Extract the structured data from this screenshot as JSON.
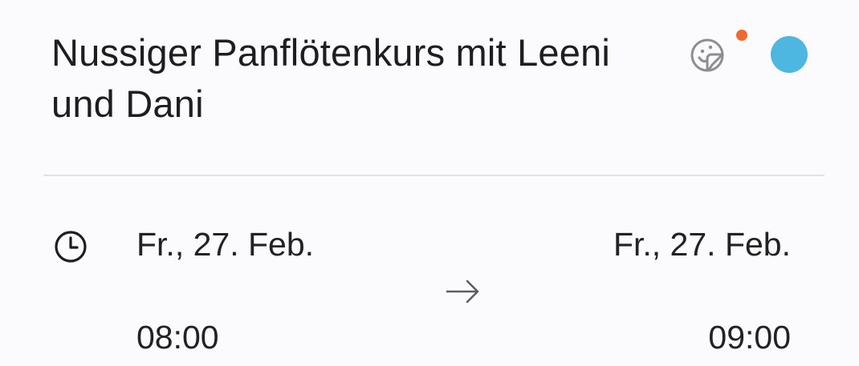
{
  "event": {
    "title": "Nussiger Panflötenkurs mit Leeni und Dani"
  },
  "header": {
    "sticker_icon": "sticker-icon",
    "notification_color": "#ef6a2c",
    "event_color": "#4db6e1"
  },
  "time": {
    "icon": "clock-icon",
    "start_date": "Fr., 27. Feb.",
    "start_time": "08:00",
    "end_date": "Fr., 27. Feb.",
    "end_time": "09:00",
    "separator_icon": "arrow-right-icon"
  }
}
